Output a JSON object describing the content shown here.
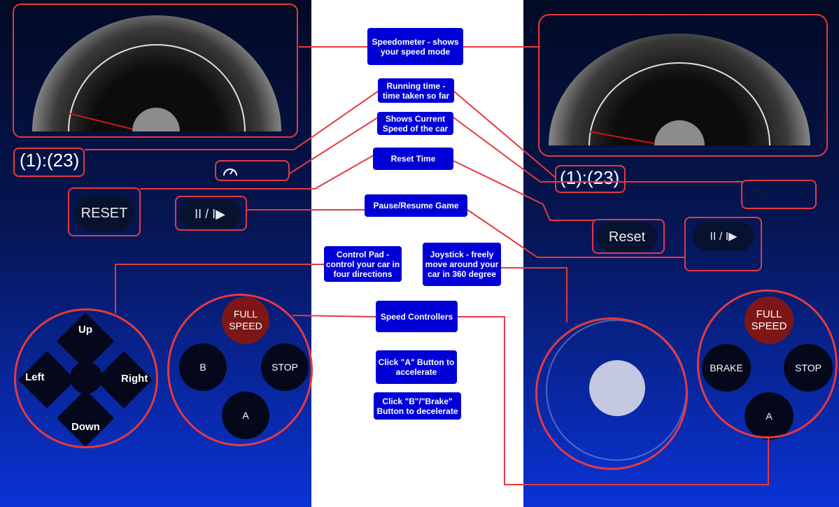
{
  "left": {
    "timer": "(1):(23)",
    "reset_label": "RESET",
    "pause_label": "II / I▶",
    "dpad": {
      "up": "Up",
      "down": "Down",
      "left": "Left",
      "right": "Right"
    },
    "buttons": {
      "full_speed": "FULL SPEED",
      "b": "B",
      "stop": "STOP",
      "a": "A"
    }
  },
  "right": {
    "timer": "(1):(23)",
    "reset_label": "Reset",
    "pause_label": "II / I▶",
    "buttons": {
      "full_speed": "FULL SPEED",
      "brake": "BRAKE",
      "stop": "STOP",
      "a": "A"
    }
  },
  "annotations": {
    "speedometer": "Speedometer - shows your speed mode",
    "running_time": "Running time - time taken so far",
    "current_speed": "Shows Current Speed of the car",
    "reset_time": "Reset Time",
    "pause_resume": "Pause/Resume Game",
    "control_pad": "Control Pad - control your car in four directions",
    "joystick": "Joystick - freely move around your car in 360 degree",
    "speed_controllers": "Speed Controllers",
    "click_a": "Click \"A\" Button to accelerate",
    "click_b": "Click \"B\"/\"Brake\" Button to decelerate"
  },
  "colors": {
    "annotation_bg": "#0000d6",
    "highlight": "#e5393f",
    "full_speed": "#7d1717"
  },
  "icons": {
    "speed": "speedometer-icon"
  }
}
